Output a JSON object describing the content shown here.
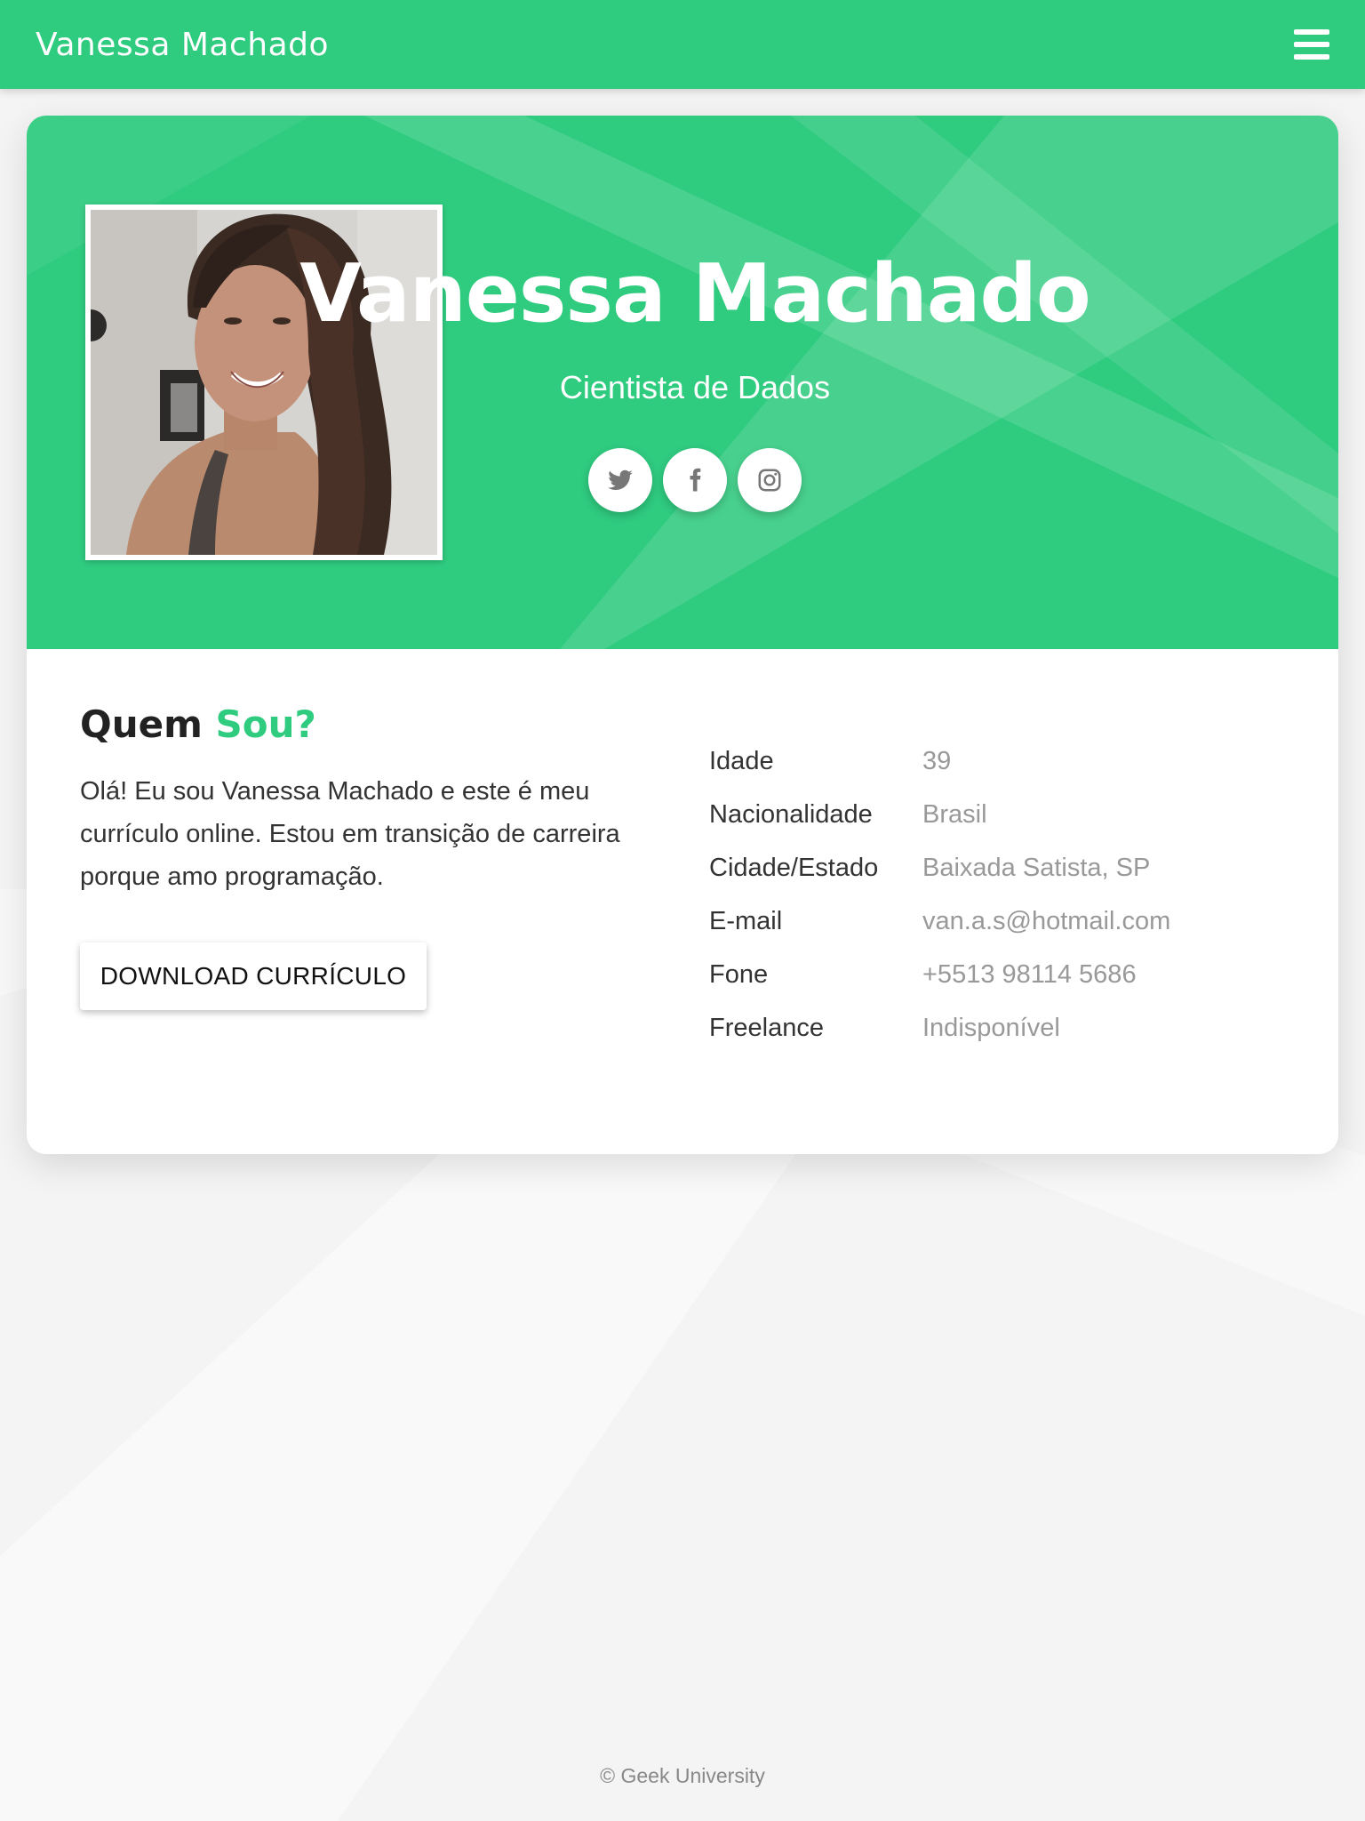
{
  "navbar": {
    "brand": "Vanessa Machado"
  },
  "hero": {
    "name": "Vanessa Machado",
    "title": "Cientista de Dados",
    "socials": [
      {
        "icon": "twitter-icon"
      },
      {
        "icon": "facebook-icon"
      },
      {
        "icon": "instagram-icon"
      }
    ]
  },
  "about": {
    "heading_main": "Quem",
    "heading_accent": "Sou?",
    "text": "Olá! Eu sou Vanessa Machado e este é meu currículo online. Estou em transição de carreira porque amo programação.",
    "download_label": "DOWNLOAD CURRÍCULO"
  },
  "info": {
    "rows": [
      {
        "label": "Idade",
        "value": "39"
      },
      {
        "label": "Nacionalidade",
        "value": "Brasil"
      },
      {
        "label": "Cidade/Estado",
        "value": "Baixada Satista, SP"
      },
      {
        "label": "E-mail",
        "value": "van.a.s@hotmail.com"
      },
      {
        "label": "Fone",
        "value": "+5513 98114 5686"
      },
      {
        "label": "Freelance",
        "value": "Indisponível"
      }
    ]
  },
  "footer": {
    "text": "© Geek University"
  },
  "colors": {
    "accent": "#2fcb7f",
    "muted": "#999999"
  }
}
